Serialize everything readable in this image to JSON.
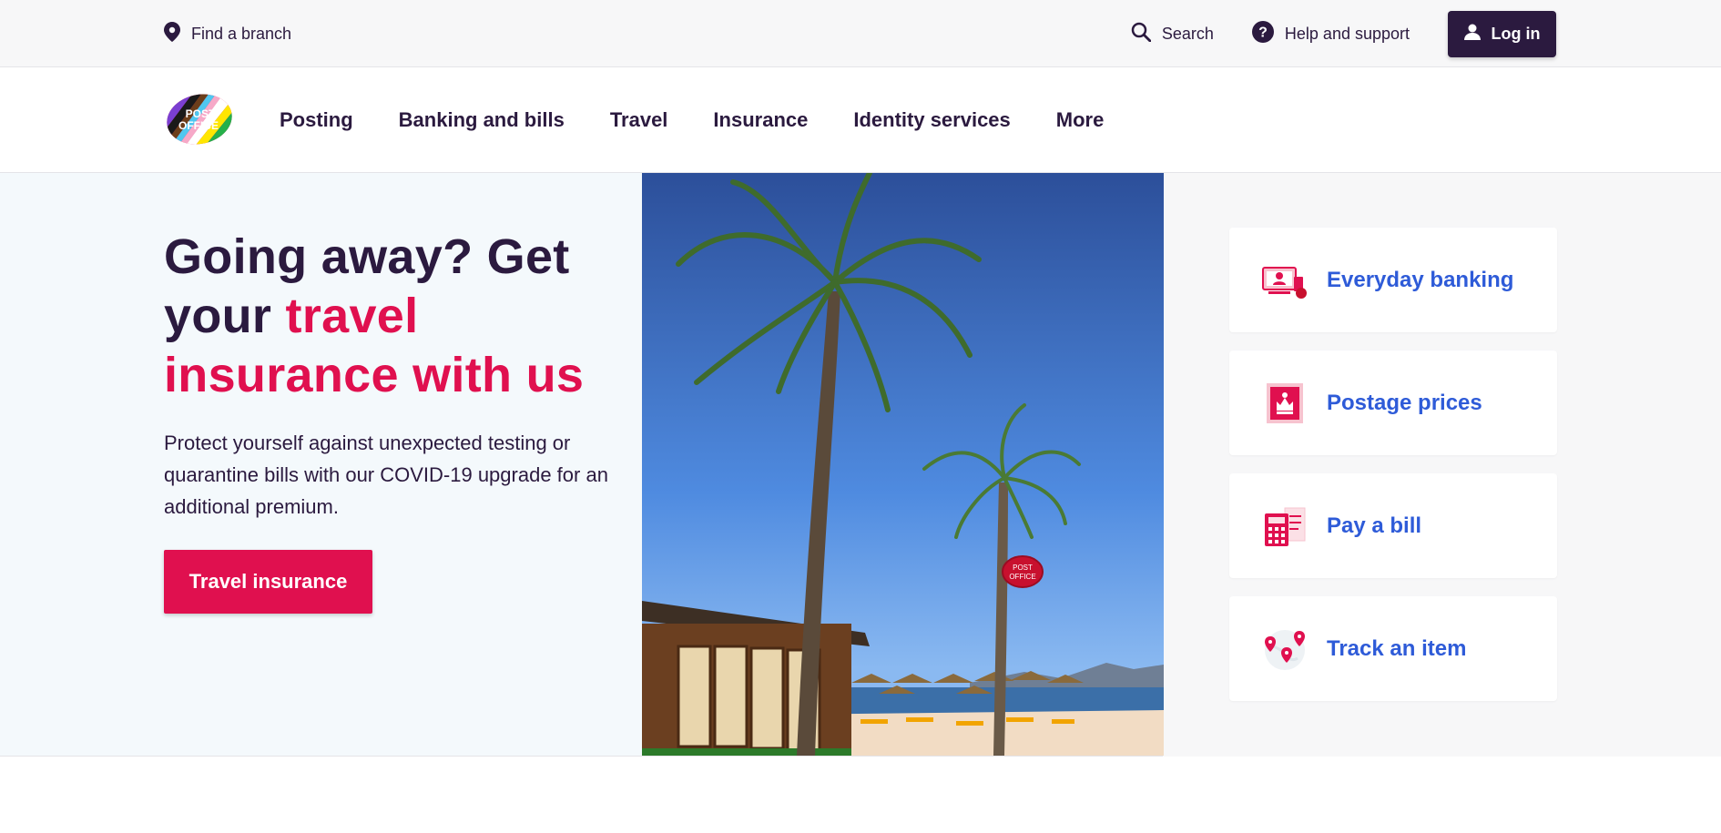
{
  "utility": {
    "find_branch": "Find a branch",
    "search": "Search",
    "help": "Help and support",
    "login": "Log in"
  },
  "logo": {
    "line1": "POST",
    "line2": "OFFICE"
  },
  "nav": {
    "items": [
      "Posting",
      "Banking and bills",
      "Travel",
      "Insurance",
      "Identity services",
      "More"
    ]
  },
  "hero": {
    "title_part1": "Going away? Get your ",
    "title_accent": "travel insurance with us",
    "body": "Protect yourself against unexpected testing or quarantine bills with our COVID-19 upgrade for an additional premium.",
    "cta": "Travel insurance",
    "image_sign_line1": "POST",
    "image_sign_line2": "OFFICE"
  },
  "quick_links": [
    {
      "label": "Everyday banking",
      "icon": "banking-icon"
    },
    {
      "label": "Postage prices",
      "icon": "royal-mail-stamp-icon"
    },
    {
      "label": "Pay a bill",
      "icon": "calculator-bill-icon"
    },
    {
      "label": "Track an item",
      "icon": "map-pins-icon"
    }
  ],
  "colors": {
    "brand_dark": "#2b1a3f",
    "accent_red": "#e0104f",
    "link_blue": "#2e5bd8",
    "hero_bg": "#f4f9fc"
  }
}
